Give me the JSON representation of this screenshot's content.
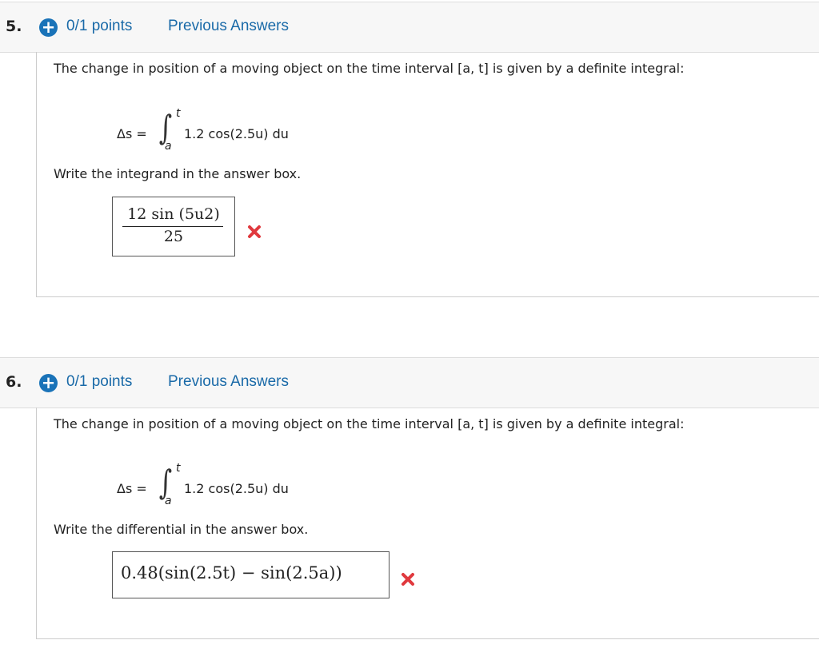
{
  "questions": [
    {
      "number": "5.",
      "points": "0/1 points",
      "previous_answers": "Previous Answers",
      "prompt": "The change in position of a moving object on the time interval [a, t] is given by a definite integral:",
      "formula": {
        "lhs": "Δs =",
        "upper_limit": "t",
        "lower_limit": "a",
        "integrand": "1.2 cos(2.5u) du"
      },
      "instruction": "Write the integrand in the answer box.",
      "answer": {
        "numerator": "12 sin (5u2)",
        "denominator": "25"
      },
      "status_icon": "incorrect-x-icon"
    },
    {
      "number": "6.",
      "points": "0/1 points",
      "previous_answers": "Previous Answers",
      "prompt": "The change in position of a moving object on the time interval [a, t] is given by a definite integral:",
      "formula": {
        "lhs": "Δs =",
        "upper_limit": "t",
        "lower_limit": "a",
        "integrand": "1.2 cos(2.5u) du"
      },
      "instruction": "Write the differential in the answer box.",
      "answer": {
        "expression": "0.48(sin(2.5t) − sin(2.5a))"
      },
      "status_icon": "incorrect-x-icon"
    }
  ],
  "colors": {
    "link": "#1a6aa8",
    "icon_blue": "#1a73b8",
    "error_red": "#e0393e"
  },
  "icons": {
    "expand": "plus-circle-icon",
    "incorrect": "x-icon"
  }
}
